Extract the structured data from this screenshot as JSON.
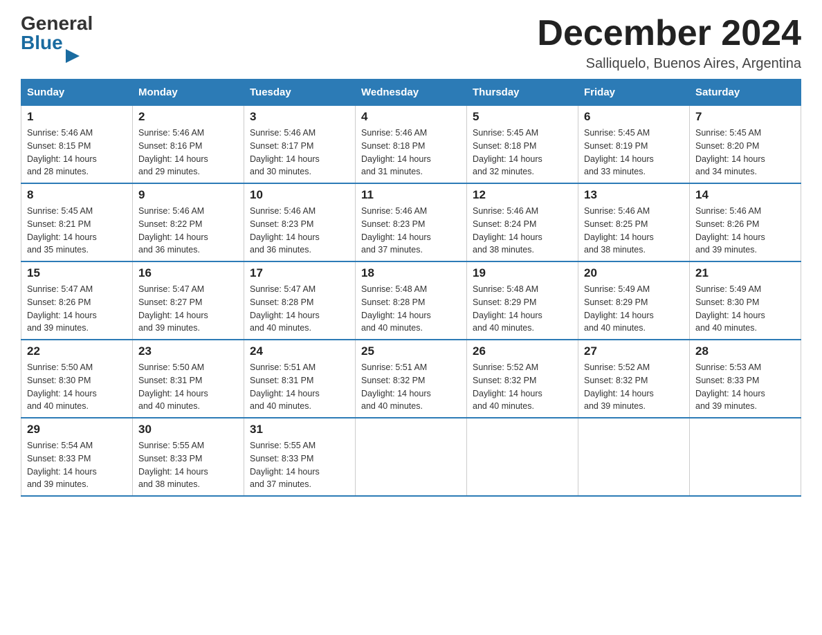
{
  "logo": {
    "general": "General",
    "blue": "Blue"
  },
  "title": "December 2024",
  "location": "Salliquelo, Buenos Aires, Argentina",
  "days_of_week": [
    "Sunday",
    "Monday",
    "Tuesday",
    "Wednesday",
    "Thursday",
    "Friday",
    "Saturday"
  ],
  "weeks": [
    [
      {
        "day": "1",
        "sunrise": "5:46 AM",
        "sunset": "8:15 PM",
        "daylight": "14 hours and 28 minutes."
      },
      {
        "day": "2",
        "sunrise": "5:46 AM",
        "sunset": "8:16 PM",
        "daylight": "14 hours and 29 minutes."
      },
      {
        "day": "3",
        "sunrise": "5:46 AM",
        "sunset": "8:17 PM",
        "daylight": "14 hours and 30 minutes."
      },
      {
        "day": "4",
        "sunrise": "5:46 AM",
        "sunset": "8:18 PM",
        "daylight": "14 hours and 31 minutes."
      },
      {
        "day": "5",
        "sunrise": "5:45 AM",
        "sunset": "8:18 PM",
        "daylight": "14 hours and 32 minutes."
      },
      {
        "day": "6",
        "sunrise": "5:45 AM",
        "sunset": "8:19 PM",
        "daylight": "14 hours and 33 minutes."
      },
      {
        "day": "7",
        "sunrise": "5:45 AM",
        "sunset": "8:20 PM",
        "daylight": "14 hours and 34 minutes."
      }
    ],
    [
      {
        "day": "8",
        "sunrise": "5:45 AM",
        "sunset": "8:21 PM",
        "daylight": "14 hours and 35 minutes."
      },
      {
        "day": "9",
        "sunrise": "5:46 AM",
        "sunset": "8:22 PM",
        "daylight": "14 hours and 36 minutes."
      },
      {
        "day": "10",
        "sunrise": "5:46 AM",
        "sunset": "8:23 PM",
        "daylight": "14 hours and 36 minutes."
      },
      {
        "day": "11",
        "sunrise": "5:46 AM",
        "sunset": "8:23 PM",
        "daylight": "14 hours and 37 minutes."
      },
      {
        "day": "12",
        "sunrise": "5:46 AM",
        "sunset": "8:24 PM",
        "daylight": "14 hours and 38 minutes."
      },
      {
        "day": "13",
        "sunrise": "5:46 AM",
        "sunset": "8:25 PM",
        "daylight": "14 hours and 38 minutes."
      },
      {
        "day": "14",
        "sunrise": "5:46 AM",
        "sunset": "8:26 PM",
        "daylight": "14 hours and 39 minutes."
      }
    ],
    [
      {
        "day": "15",
        "sunrise": "5:47 AM",
        "sunset": "8:26 PM",
        "daylight": "14 hours and 39 minutes."
      },
      {
        "day": "16",
        "sunrise": "5:47 AM",
        "sunset": "8:27 PM",
        "daylight": "14 hours and 39 minutes."
      },
      {
        "day": "17",
        "sunrise": "5:47 AM",
        "sunset": "8:28 PM",
        "daylight": "14 hours and 40 minutes."
      },
      {
        "day": "18",
        "sunrise": "5:48 AM",
        "sunset": "8:28 PM",
        "daylight": "14 hours and 40 minutes."
      },
      {
        "day": "19",
        "sunrise": "5:48 AM",
        "sunset": "8:29 PM",
        "daylight": "14 hours and 40 minutes."
      },
      {
        "day": "20",
        "sunrise": "5:49 AM",
        "sunset": "8:29 PM",
        "daylight": "14 hours and 40 minutes."
      },
      {
        "day": "21",
        "sunrise": "5:49 AM",
        "sunset": "8:30 PM",
        "daylight": "14 hours and 40 minutes."
      }
    ],
    [
      {
        "day": "22",
        "sunrise": "5:50 AM",
        "sunset": "8:30 PM",
        "daylight": "14 hours and 40 minutes."
      },
      {
        "day": "23",
        "sunrise": "5:50 AM",
        "sunset": "8:31 PM",
        "daylight": "14 hours and 40 minutes."
      },
      {
        "day": "24",
        "sunrise": "5:51 AM",
        "sunset": "8:31 PM",
        "daylight": "14 hours and 40 minutes."
      },
      {
        "day": "25",
        "sunrise": "5:51 AM",
        "sunset": "8:32 PM",
        "daylight": "14 hours and 40 minutes."
      },
      {
        "day": "26",
        "sunrise": "5:52 AM",
        "sunset": "8:32 PM",
        "daylight": "14 hours and 40 minutes."
      },
      {
        "day": "27",
        "sunrise": "5:52 AM",
        "sunset": "8:32 PM",
        "daylight": "14 hours and 39 minutes."
      },
      {
        "day": "28",
        "sunrise": "5:53 AM",
        "sunset": "8:33 PM",
        "daylight": "14 hours and 39 minutes."
      }
    ],
    [
      {
        "day": "29",
        "sunrise": "5:54 AM",
        "sunset": "8:33 PM",
        "daylight": "14 hours and 39 minutes."
      },
      {
        "day": "30",
        "sunrise": "5:55 AM",
        "sunset": "8:33 PM",
        "daylight": "14 hours and 38 minutes."
      },
      {
        "day": "31",
        "sunrise": "5:55 AM",
        "sunset": "8:33 PM",
        "daylight": "14 hours and 37 minutes."
      },
      null,
      null,
      null,
      null
    ]
  ],
  "labels": {
    "sunrise": "Sunrise:",
    "sunset": "Sunset:",
    "daylight": "Daylight:"
  }
}
